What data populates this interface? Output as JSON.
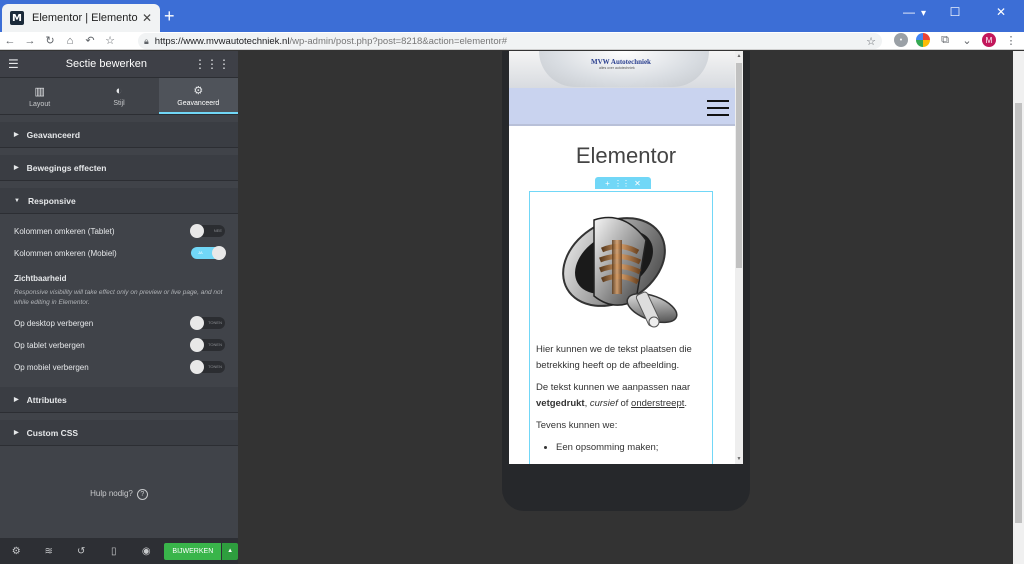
{
  "browser": {
    "tab_title": "Elementor | Elementor",
    "favicon_letter": "M",
    "new_tab": "+",
    "url_host": "https://www.mvwautotechniek.nl",
    "url_path": "/wp-admin/post.php?post=8218&action=elementor#",
    "avatar_letter": "M"
  },
  "panel": {
    "title": "Sectie bewerken",
    "tabs": [
      {
        "label": "Layout",
        "icon": "layout-icon"
      },
      {
        "label": "Stijl",
        "icon": "contrast-icon"
      },
      {
        "label": "Geavanceerd",
        "icon": "gear-icon"
      }
    ],
    "sections": {
      "advanced": "Geavanceerd",
      "motion": "Bewegings effecten",
      "responsive": "Responsive",
      "attributes": "Attributes",
      "custom_css": "Custom CSS"
    },
    "reverse_tablet": {
      "label": "Kolommen omkeren (Tablet)",
      "switch": "NEE",
      "on": false
    },
    "reverse_mobile": {
      "label": "Kolommen omkeren (Mobiel)",
      "switch": "JA",
      "on": true
    },
    "visibility_heading": "Zichtbaarheid",
    "visibility_note": "Responsive visibility will take effect only on preview or live page, and not while editing in Elementor.",
    "hide_desktop": {
      "label": "Op desktop verbergen",
      "switch": "TONEN"
    },
    "hide_tablet": {
      "label": "Op tablet verbergen",
      "switch": "TONEN"
    },
    "hide_mobile": {
      "label": "Op mobiel verbergen",
      "switch": "TONEN"
    },
    "help_text": "Hulp nodig?",
    "update_button": "BIJWERKEN"
  },
  "preview": {
    "logo_text": "MVW Autotechniek",
    "logo_sub": "alles over autotechniek",
    "page_title": "Elementor",
    "para1": "Hier kunnen we de tekst plaatsen die betrekking heeft op de afbeelding.",
    "para2_start": "De tekst kunnen we aanpassen naar ",
    "para2_bold": "vetgedrukt",
    "para2_sep1": ", ",
    "para2_italic": "cursief",
    "para2_sep2": " of ",
    "para2_underline": "onderstreept",
    "para2_end": ".",
    "para3": "Tevens kunnen we:",
    "list_item1": "Een opsomming maken;"
  },
  "colors": {
    "titlebar": "#3c6ed6",
    "panel_bg": "#404349",
    "accent": "#71d7f7",
    "update_green": "#39b54a",
    "navbar_bg": "#c9d3ef"
  }
}
